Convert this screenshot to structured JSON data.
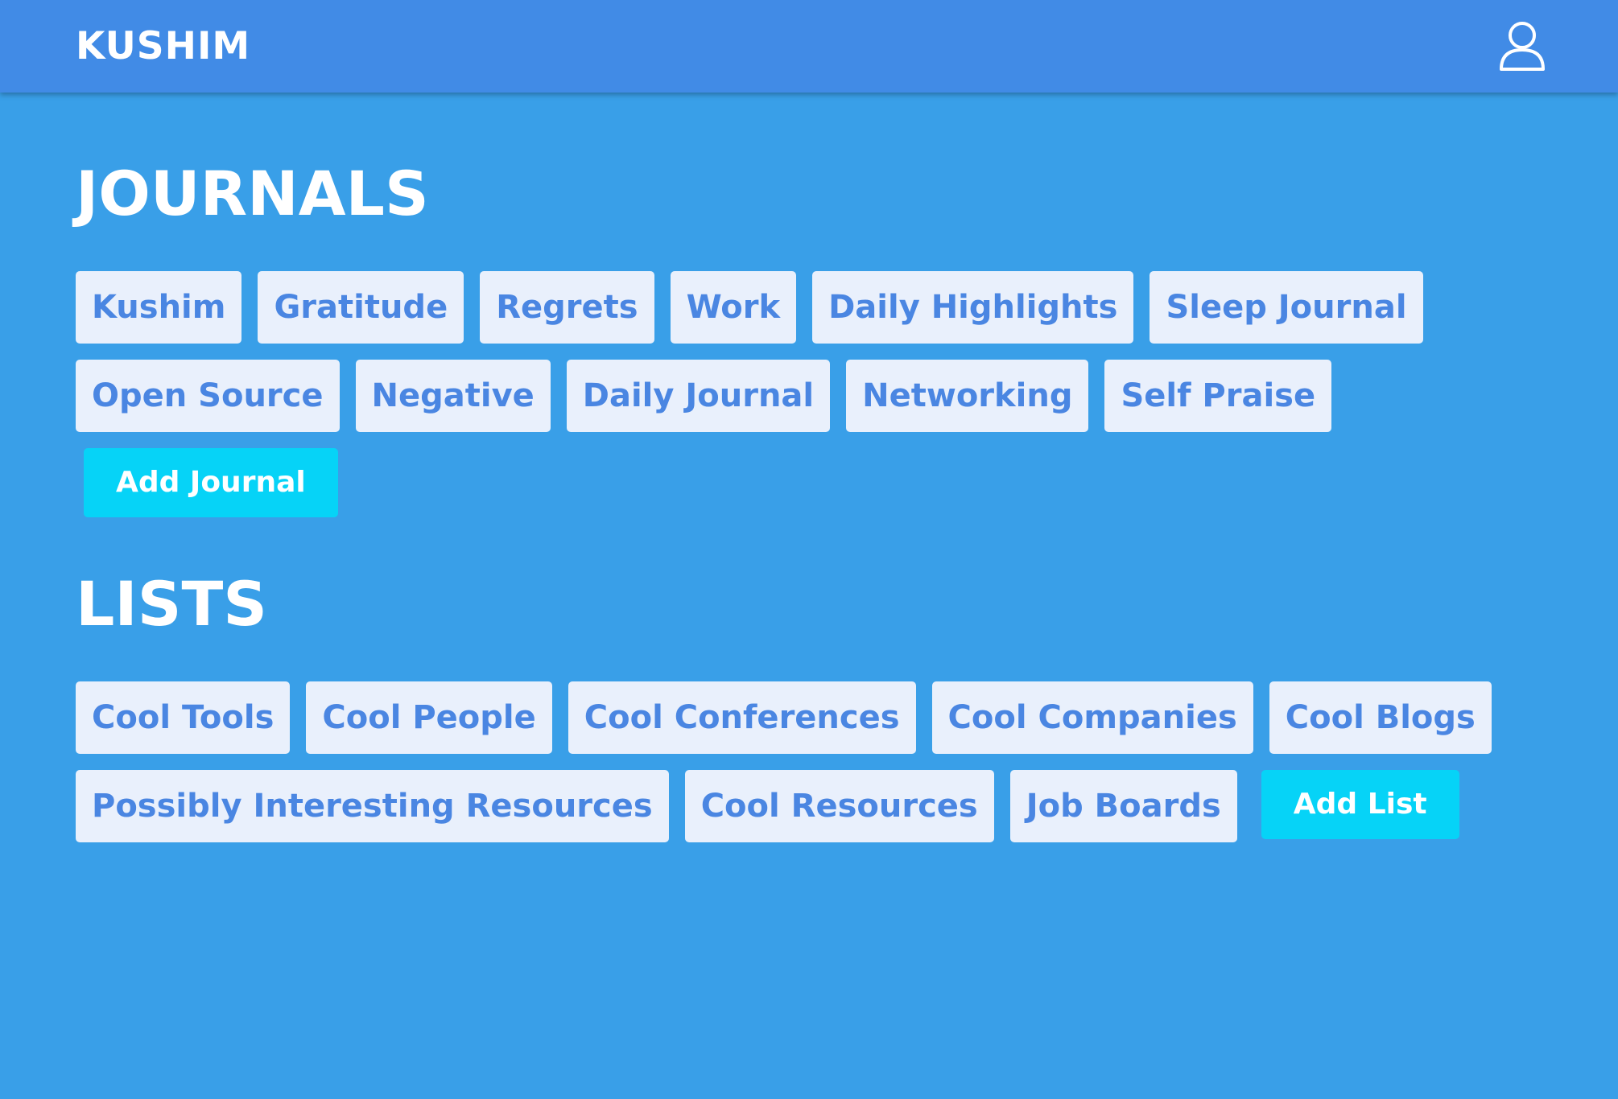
{
  "header": {
    "brand": "KUSHIM",
    "user_icon": "user-icon"
  },
  "journals": {
    "title": "JOURNALS",
    "items": [
      {
        "label": "Kushim"
      },
      {
        "label": "Gratitude"
      },
      {
        "label": "Regrets"
      },
      {
        "label": "Work"
      },
      {
        "label": "Daily Highlights"
      },
      {
        "label": "Sleep Journal"
      },
      {
        "label": "Open Source"
      },
      {
        "label": "Negative"
      },
      {
        "label": "Daily Journal"
      },
      {
        "label": "Networking"
      },
      {
        "label": "Self Praise"
      }
    ],
    "add_label": "Add Journal"
  },
  "lists": {
    "title": "LISTS",
    "items": [
      {
        "label": "Cool Tools"
      },
      {
        "label": "Cool People"
      },
      {
        "label": "Cool Conferences"
      },
      {
        "label": "Cool Companies"
      },
      {
        "label": "Cool Blogs"
      },
      {
        "label": "Possibly Interesting Resources"
      },
      {
        "label": "Cool Resources"
      },
      {
        "label": "Job Boards"
      }
    ],
    "add_label": "Add List"
  },
  "colors": {
    "page_background": "#399fe8",
    "navbar": "#418be6",
    "chip_background": "#e9f0fc",
    "chip_text": "#4a86e2",
    "add_button": "#06d3f7"
  }
}
